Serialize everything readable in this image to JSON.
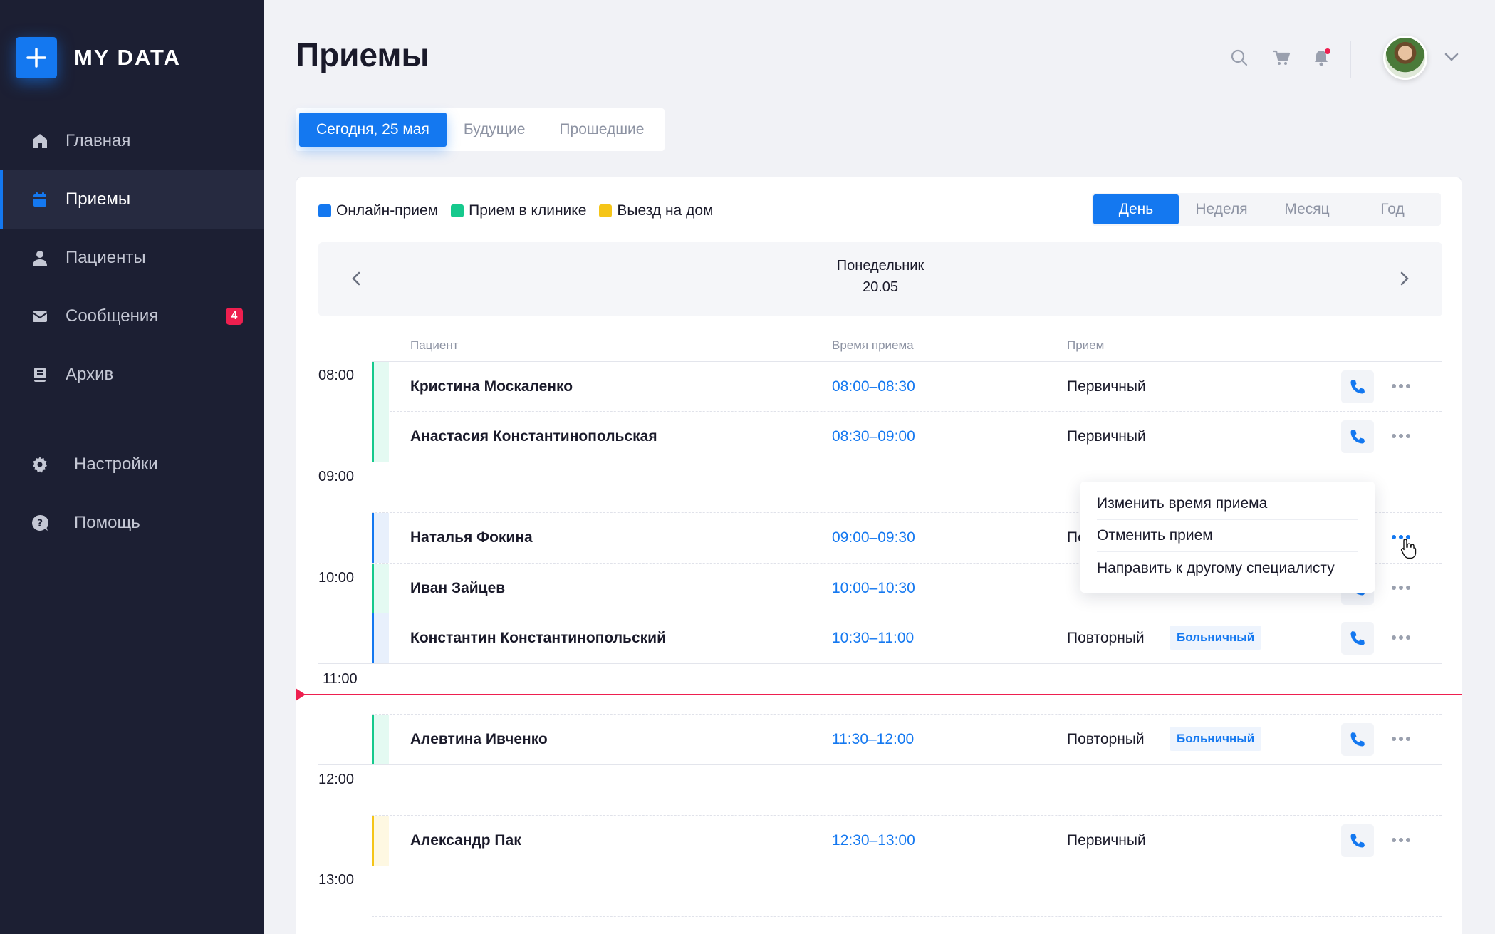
{
  "app": {
    "logo_text": "MY DATA"
  },
  "sidebar": {
    "items": [
      {
        "label": "Главная",
        "icon": "home-icon"
      },
      {
        "label": "Приемы",
        "icon": "calendar-icon",
        "active": true
      },
      {
        "label": "Пациенты",
        "icon": "user-icon"
      },
      {
        "label": "Сообщения",
        "icon": "mail-icon",
        "badge": "4"
      },
      {
        "label": "Архив",
        "icon": "archive-icon"
      }
    ],
    "secondary": [
      {
        "label": "Настройки",
        "icon": "gear-icon"
      },
      {
        "label": "Помощь",
        "icon": "help-icon"
      }
    ]
  },
  "header": {
    "title": "Приемы"
  },
  "tabs": {
    "today": "Сегодня, 25 мая",
    "future": "Будущие",
    "past": "Прошедшие"
  },
  "legend": {
    "online": {
      "label": "Онлайн-прием",
      "color": "#1478f0"
    },
    "clinic": {
      "label": "Прием в клинике",
      "color": "#16c98d"
    },
    "home": {
      "label": "Выезд на дом",
      "color": "#f5c518"
    }
  },
  "view": {
    "day": "День",
    "week": "Неделя",
    "month": "Месяц",
    "year": "Год"
  },
  "day_nav": {
    "weekday": "Понедельник",
    "date": "20.05"
  },
  "table": {
    "headers": {
      "patient": "Пациент",
      "time": "Время приема",
      "type": "Прием"
    },
    "hours": [
      "08:00",
      "09:00",
      "10:00",
      "11:00",
      "12:00",
      "13:00"
    ],
    "appointments": [
      {
        "patient": "Кристина Москаленко",
        "time": "08:00–08:30",
        "type": "Первичный",
        "tag": "",
        "kind": "clinic"
      },
      {
        "patient": "Анастасия Константинопольская",
        "time": "08:30–09:00",
        "type": "Первичный",
        "tag": "",
        "kind": "clinic"
      },
      {
        "patient": "Наталья Фокина",
        "time": "09:00–09:30",
        "type": "Пе",
        "tag": "",
        "kind": "online"
      },
      {
        "patient": "Иван Зайцев",
        "time": "10:00–10:30",
        "type": "",
        "tag": "",
        "kind": "clinic"
      },
      {
        "patient": "Константин Константинопольский",
        "time": "10:30–11:00",
        "type": "Повторный",
        "tag": "Больничный",
        "kind": "online"
      },
      {
        "patient": "Алевтина Ивченко",
        "time": "11:30–12:00",
        "type": "Повторный",
        "tag": "Больничный",
        "kind": "clinic"
      },
      {
        "patient": "Александр Пак",
        "time": "12:30–13:00",
        "type": "Первичный",
        "tag": "",
        "kind": "home"
      }
    ]
  },
  "context_menu": {
    "items": [
      "Изменить время приема",
      "Отменить прием",
      "Направить к другому специалисту"
    ]
  }
}
